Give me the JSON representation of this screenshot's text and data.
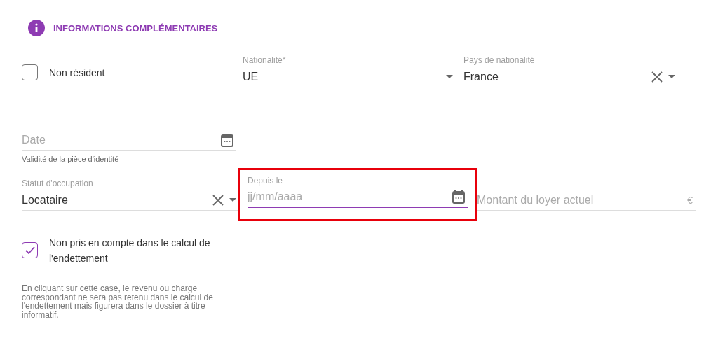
{
  "section": {
    "title": "INFORMATIONS COMPLÉMENTAIRES"
  },
  "non_resident": {
    "label": "Non résident",
    "checked": false
  },
  "nationality": {
    "label": "Nationalité*",
    "value": "UE"
  },
  "country": {
    "label": "Pays de nationalité",
    "value": "France"
  },
  "id_validity": {
    "placeholder": "Date",
    "helper": "Validité de la pièce d'identité"
  },
  "occupancy": {
    "label": "Statut d'occupation",
    "value": "Locataire"
  },
  "since": {
    "label": "Depuis le",
    "placeholder": "jj/mm/aaaa",
    "focused": true,
    "highlighted": true
  },
  "rent": {
    "placeholder": "Montant du loyer actuel",
    "unit": "€"
  },
  "exclude": {
    "label": "Non pris en compte dans le calcul de l'endettement",
    "checked": true,
    "note": "En cliquant sur cette case, le revenu ou charge correspondant ne sera pas retenu dans le calcul de l'endettement mais figurera dans le dossier à titre informatif."
  }
}
